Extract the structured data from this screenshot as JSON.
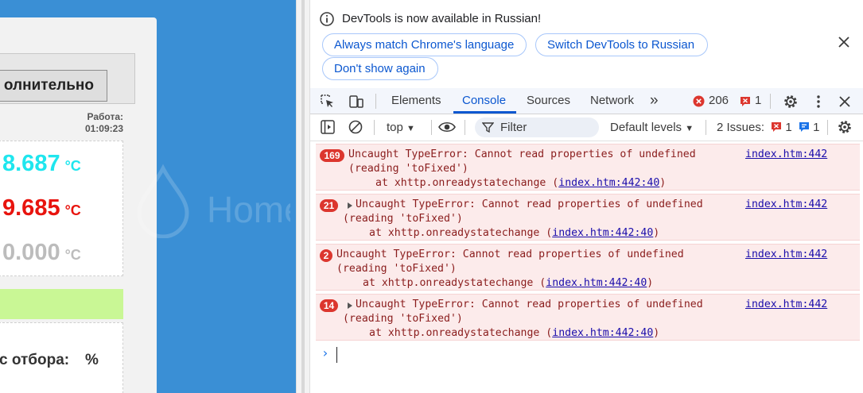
{
  "page": {
    "extra_button_label": "олнительно",
    "work_label": "Работа:",
    "work_time": "01:09:23",
    "temps": [
      {
        "value": "8.687",
        "unit": "°C",
        "color": "#1fe6ee"
      },
      {
        "value": "9.685",
        "unit": "°C",
        "color": "#e8140e"
      },
      {
        "value": "0.000",
        "unit": "°C",
        "color": "#bcbcbc"
      }
    ],
    "selection_label": "с отбора:",
    "selection_unit": "%",
    "watermark": "HomeDistiller.ru"
  },
  "banner": {
    "message": "DevTools is now available in Russian!",
    "match_button": "Always match Chrome's language",
    "switch_button": "Switch DevTools to Russian",
    "dont_show_button": "Don't show again"
  },
  "tabs": {
    "elements": "Elements",
    "console": "Console",
    "sources": "Sources",
    "network": "Network",
    "more": "»",
    "error_count": "206",
    "warning_count": "1"
  },
  "toolbar": {
    "context": "top",
    "filter_placeholder": "Filter",
    "levels": "Default levels",
    "issues_label": "2 Issues:",
    "issues_error_count": "1",
    "issues_info_count": "1"
  },
  "messages": [
    {
      "count": "169",
      "text": "Uncaught TypeError: Cannot read properties of undefined",
      "text2": "(reading 'toFixed')",
      "trace_prefix": "at xhttp.onreadystatechange (",
      "trace_link": "index.htm:442:40",
      "trace_suffix": ")",
      "source": "index.htm:442",
      "expandable": false
    },
    {
      "count": "21",
      "text": "Uncaught TypeError: Cannot read properties of undefined",
      "text2": "(reading 'toFixed')",
      "trace_prefix": "at xhttp.onreadystatechange (",
      "trace_link": "index.htm:442:40",
      "trace_suffix": ")",
      "source": "index.htm:442",
      "expandable": true
    },
    {
      "count": "2",
      "text": "Uncaught TypeError: Cannot read properties of undefined",
      "text2": "(reading 'toFixed')",
      "trace_prefix": "at xhttp.onreadystatechange (",
      "trace_link": "index.htm:442:40",
      "trace_suffix": ")",
      "source": "index.htm:442",
      "expandable": false
    },
    {
      "count": "14",
      "text": "Uncaught TypeError: Cannot read properties of undefined",
      "text2": "(reading 'toFixed')",
      "trace_prefix": "at xhttp.onreadystatechange (",
      "trace_link": "index.htm:442:40",
      "trace_suffix": ")",
      "source": "index.htm:442",
      "expandable": true
    }
  ],
  "console_prompt": "›"
}
